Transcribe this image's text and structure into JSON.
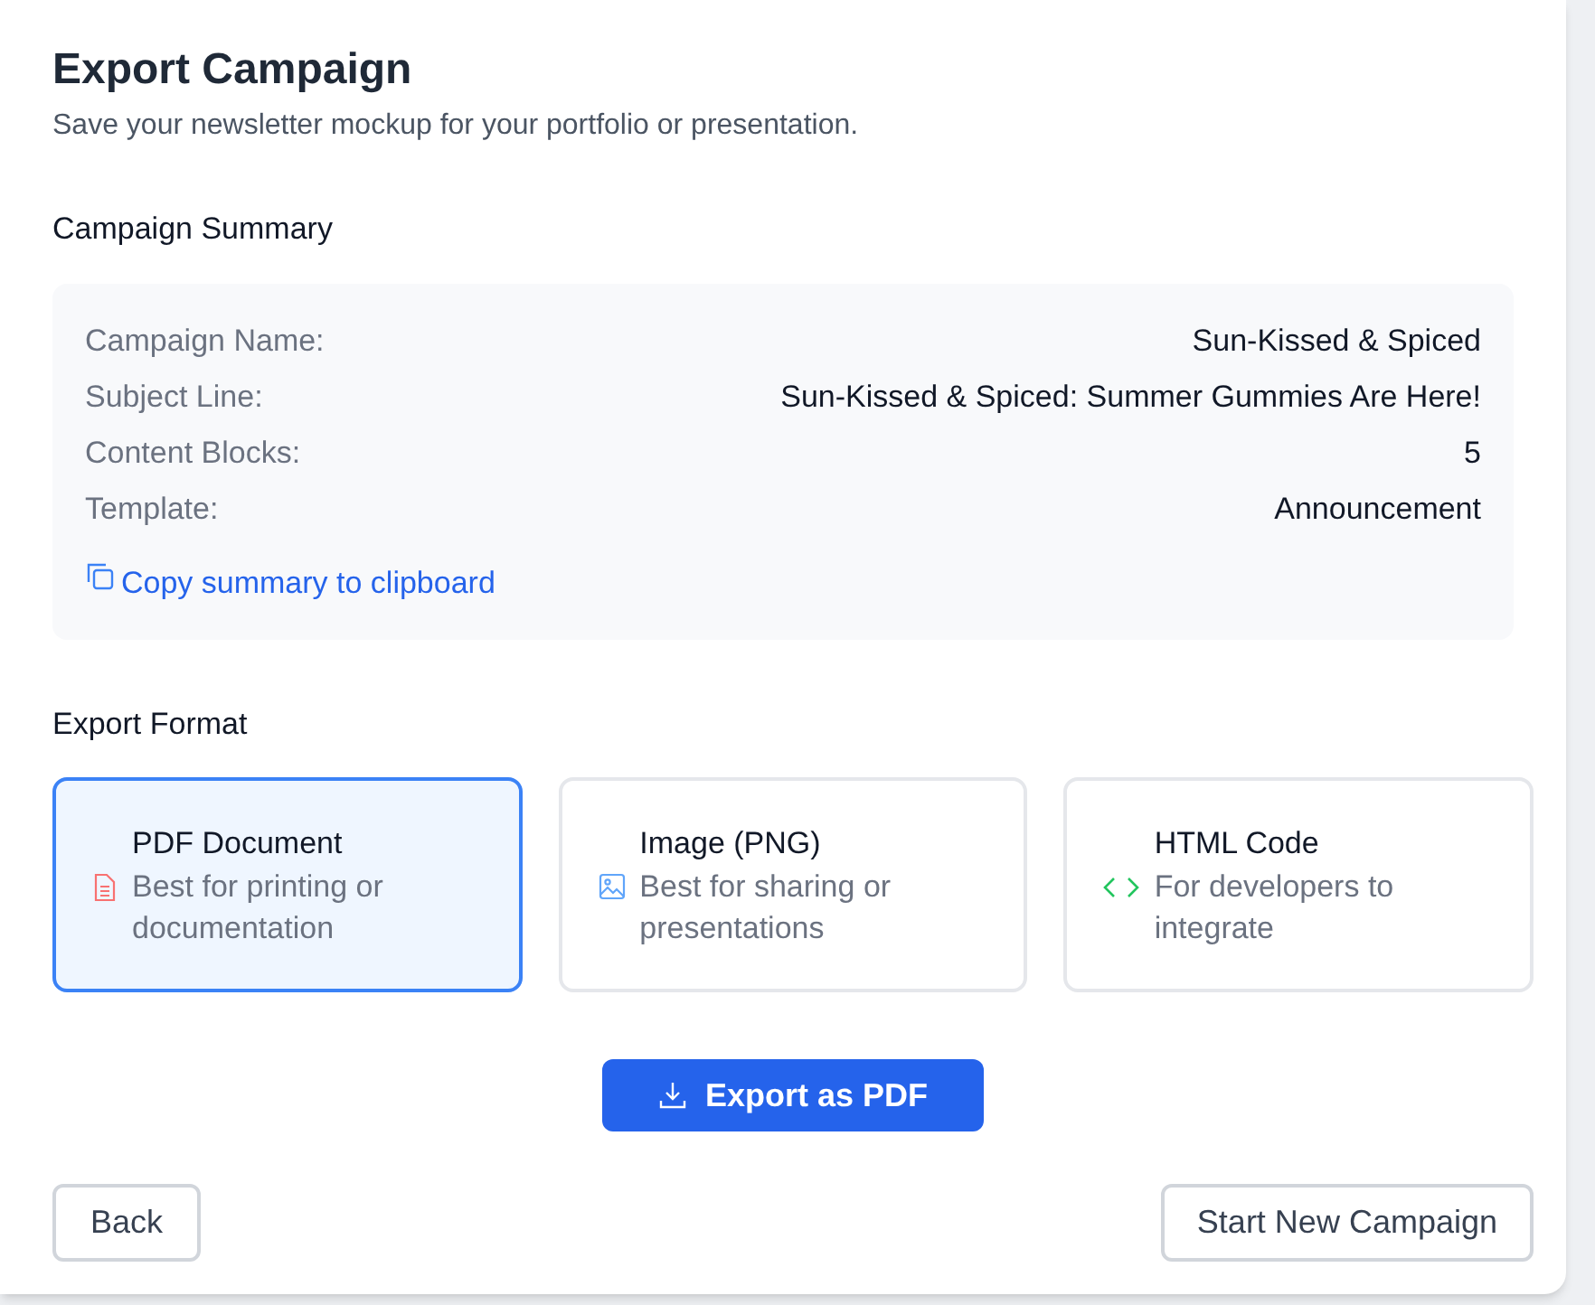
{
  "title": "Export Campaign",
  "subtitle": "Save your newsletter mockup for your portfolio or presentation.",
  "summary": {
    "heading": "Campaign Summary",
    "rows": [
      {
        "label": "Campaign Name:",
        "value": "Sun-Kissed & Spiced"
      },
      {
        "label": "Subject Line:",
        "value": "Sun-Kissed & Spiced: Summer Gummies Are Here!"
      },
      {
        "label": "Content Blocks:",
        "value": "5"
      },
      {
        "label": "Template:",
        "value": "Announcement"
      }
    ],
    "copy_link": "Copy summary to clipboard"
  },
  "export_format": {
    "heading": "Export Format",
    "options": [
      {
        "kind": "pdf",
        "title": "PDF Document",
        "description": "Best for printing or documentation",
        "selected": true
      },
      {
        "kind": "image",
        "title": "Image (PNG)",
        "description": "Best for sharing or presentations",
        "selected": false
      },
      {
        "kind": "html",
        "title": "HTML Code",
        "description": "For developers to integrate",
        "selected": false
      }
    ]
  },
  "export_button": "Export as PDF",
  "back_button": "Back",
  "new_campaign_button": "Start New Campaign"
}
